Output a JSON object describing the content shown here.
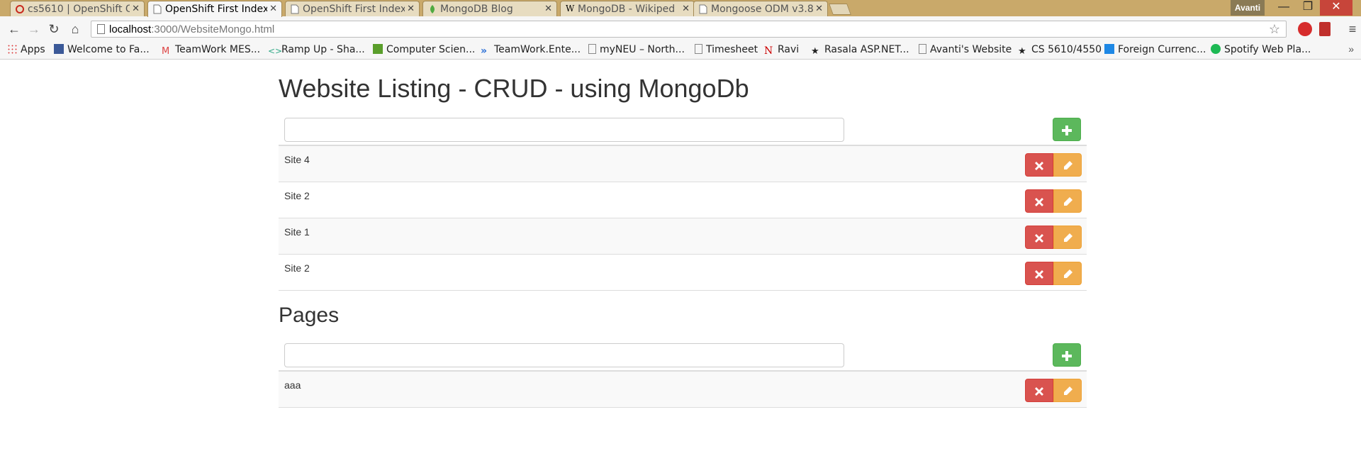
{
  "browser": {
    "tabs": [
      {
        "label": "cs5610 | OpenShift O",
        "icon": "openshift-icon"
      },
      {
        "label": "OpenShift First Index",
        "icon": "page-icon",
        "active": true
      },
      {
        "label": "OpenShift First Index",
        "icon": "page-icon"
      },
      {
        "label": "MongoDB Blog",
        "icon": "mongodb-leaf-icon"
      },
      {
        "label": "MongoDB - Wikiped",
        "icon": "wikipedia-icon"
      },
      {
        "label": "Mongoose ODM v3.8",
        "icon": "page-icon"
      }
    ],
    "profile": "Avanti",
    "url_host": "localhost",
    "url_rest": ":3000/WebsiteMongo.html",
    "bookmarks": [
      {
        "label": "Apps",
        "icon": "apps-grid-icon"
      },
      {
        "label": "Welcome to Fa...",
        "icon": "facebook-icon"
      },
      {
        "label": "TeamWork MES...",
        "icon": "gmail-icon"
      },
      {
        "label": "Ramp Up - Sha...",
        "icon": "code-icon"
      },
      {
        "label": "Computer Scien...",
        "icon": "d-icon"
      },
      {
        "label": "TeamWork.Ente...",
        "icon": "chevrons-icon"
      },
      {
        "label": "myNEU – North...",
        "icon": "page-icon"
      },
      {
        "label": "Timesheet",
        "icon": "page-icon"
      },
      {
        "label": "Ravi",
        "icon": "n-icon"
      },
      {
        "label": "Rasala ASP.NET...",
        "icon": "star-icon"
      },
      {
        "label": "Avanti's Website",
        "icon": "page-icon"
      },
      {
        "label": "CS 5610/4550",
        "icon": "star-icon"
      },
      {
        "label": "Foreign Currenc...",
        "icon": "square-icon"
      },
      {
        "label": "Spotify Web Pla...",
        "icon": "spotify-icon"
      }
    ],
    "more": "»"
  },
  "page": {
    "title": "Website Listing - CRUD - using MongoDb",
    "websites": {
      "input_value": "",
      "rows": [
        "Site 4",
        "Site 2",
        "Site 1",
        "Site 2"
      ]
    },
    "pages": {
      "title": "Pages",
      "input_value": "",
      "rows": [
        "aaa"
      ]
    }
  },
  "colors": {
    "add": "#5cb85c",
    "delete": "#d9534f",
    "edit": "#f0ad4e"
  }
}
